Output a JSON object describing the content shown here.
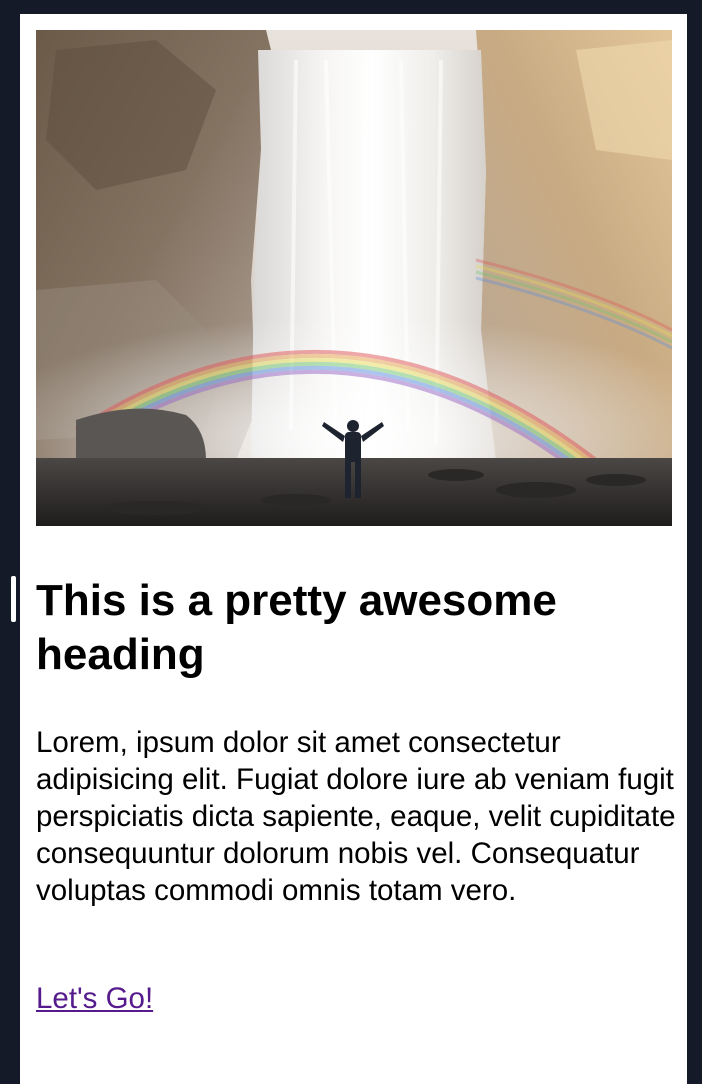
{
  "card": {
    "title": "This is a pretty awesome heading",
    "body": "Lorem, ipsum dolor sit amet consectetur adipisicing elit. Fugiat dolore iure ab veniam fugit perspiciatis dicta sapiente, eaque, velit cupiditate consequuntur dolorum nobis vel. Consequatur voluptas commodi omnis totam vero.",
    "link_label": "Let's Go!"
  },
  "colors": {
    "page_background": "#141a27",
    "card_background": "#ffffff",
    "link": "#551a8b"
  }
}
